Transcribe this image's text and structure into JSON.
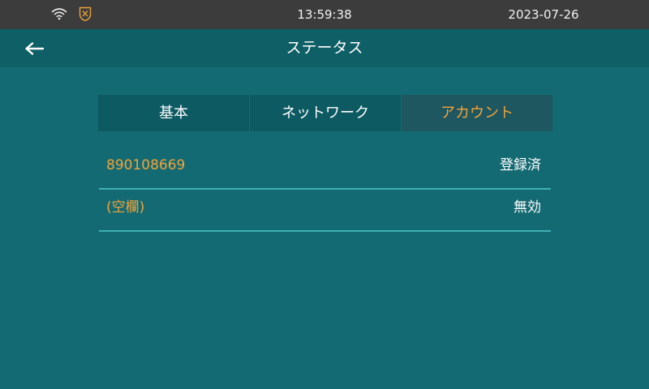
{
  "status_bar": {
    "time": "13:59:38",
    "date": "2023-07-26",
    "icons": [
      "wifi-icon",
      "shield-icon"
    ]
  },
  "header": {
    "title": "ステータス",
    "back_icon": "back-arrow-icon"
  },
  "tabs": [
    {
      "label": "基本",
      "active": false
    },
    {
      "label": "ネットワーク",
      "active": false
    },
    {
      "label": "アカウント",
      "active": true
    }
  ],
  "accounts": [
    {
      "name": "890108669",
      "status": "登録済"
    },
    {
      "name": "(空欄)",
      "status": "無効"
    }
  ],
  "colors": {
    "background": "#146a72",
    "status_bar": "#3c3c3c",
    "title_bar": "#0f5f66",
    "accent": "#f2a33a",
    "divider": "#3fb0b5"
  }
}
